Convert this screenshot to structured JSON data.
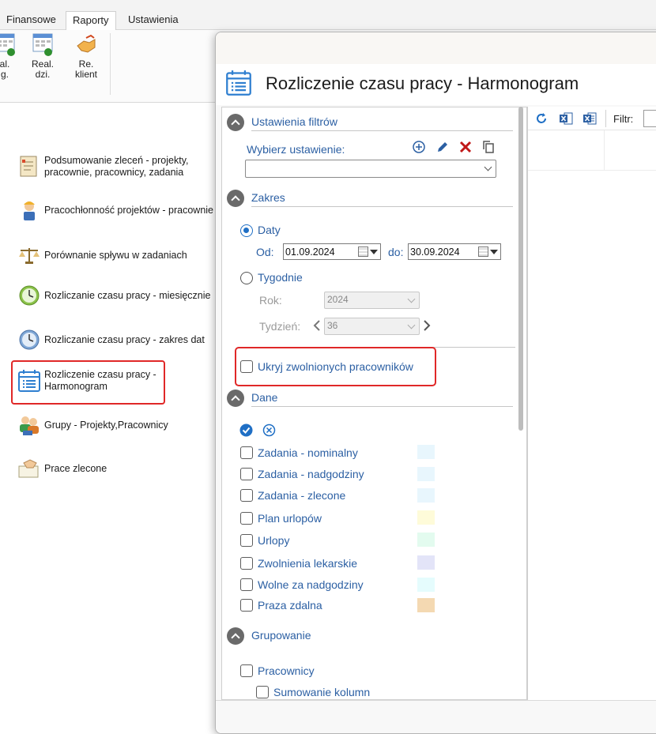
{
  "ribbon": {
    "tabs": [
      "Finansowe",
      "Raporty",
      "Ustawienia"
    ],
    "buttons": [
      {
        "label": "al.\ng."
      },
      {
        "label": "Real.\ndzi."
      },
      {
        "label": "Re.\nklient"
      }
    ]
  },
  "reports": [
    {
      "label": "Podsumowanie zleceń - projekty, pracownie, pracownicy, zadania"
    },
    {
      "label": "Pracochłonność projektów - pracownie"
    },
    {
      "label": "Porównanie spływu w zadaniach"
    },
    {
      "label": "Rozliczanie czasu pracy - miesięcznie"
    },
    {
      "label": "Rozliczanie czasu pracy - zakres dat"
    },
    {
      "label": "Rozliczenie czasu pracy - Harmonogram"
    },
    {
      "label": "Grupy - Projekty,Pracownicy"
    },
    {
      "label": "Prace zlecone"
    }
  ],
  "dialog": {
    "title": "Rozliczenie czasu pracy - Harmonogram",
    "filter_settings": {
      "section_title": "Ustawienia filtrów",
      "choose_label": "Wybierz ustawienie:",
      "selected_value": ""
    },
    "range": {
      "section_title": "Zakres",
      "dates_option": "Daty",
      "from_label": "Od:",
      "from_value": "01.09.2024",
      "to_label": "do:",
      "to_value": "30.09.2024",
      "weeks_option": "Tygodnie",
      "year_label": "Rok:",
      "year_value": "2024",
      "week_label": "Tydzień:",
      "week_value": "36"
    },
    "hide_fired_label": "Ukryj zwolnionych pracowników",
    "data": {
      "section_title": "Dane",
      "items": [
        {
          "label": "Zadania - nominalny",
          "color": "#e8f6fd"
        },
        {
          "label": "Zadania - nadgodziny",
          "color": "#e8f6fd"
        },
        {
          "label": "Zadania - zlecone",
          "color": "#e8f6fd"
        },
        {
          "label": "Plan urlopów",
          "color": "#fefbd9"
        },
        {
          "label": "Urlopy",
          "color": "#e3fbef"
        },
        {
          "label": "Zwolnienia lekarskie",
          "color": "#e3e4f8"
        },
        {
          "label": "Wolne za nadgodziny",
          "color": "#e5fcfd"
        },
        {
          "label": "Praza zdalna",
          "color": "#f4d9b2"
        }
      ]
    },
    "grouping": {
      "section_title": "Grupowanie",
      "employees": "Pracownicy",
      "sum_columns": "Sumowanie kolumn"
    },
    "toolbar": {
      "filter_label": "Filtr:"
    }
  }
}
